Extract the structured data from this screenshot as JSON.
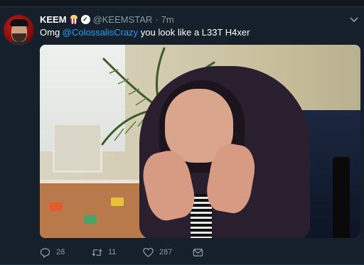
{
  "tweet": {
    "author_name": "KEEM",
    "author_handle": "@KEEMSTAR",
    "separator": "·",
    "timestamp": "7m",
    "text_prefix": "Omg ",
    "mention": "@ColossalisCrazy",
    "text_suffix": " you look like a L33T H4xer"
  },
  "actions": {
    "reply_count": "28",
    "retweet_count": "11",
    "like_count": "287"
  },
  "icons": {
    "name_badge": "popcorn-icon",
    "verified": "verified-icon",
    "caret": "chevron-down-icon",
    "reply": "reply-icon",
    "retweet": "retweet-icon",
    "like": "heart-icon",
    "dm": "envelope-icon"
  },
  "colors": {
    "background": "#15202b",
    "mention": "#1da1f2",
    "muted": "#8899a6"
  }
}
